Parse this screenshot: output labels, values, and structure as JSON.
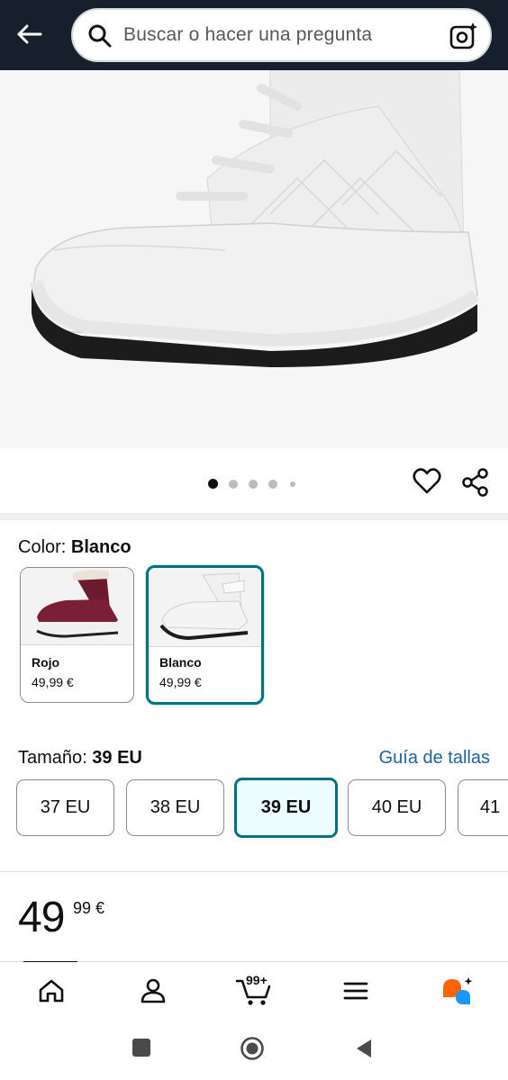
{
  "search": {
    "placeholder": "Buscar o hacer una pregunta"
  },
  "gallery": {
    "image_count": 5,
    "active_index": 0
  },
  "color": {
    "label": "Color:",
    "selected": "Blanco",
    "options": [
      {
        "name": "Rojo",
        "price": "49,99 €",
        "selected": false,
        "tint": "#7a1f36"
      },
      {
        "name": "Blanco",
        "price": "49,99 €",
        "selected": true,
        "tint": "#f2f2f2"
      }
    ]
  },
  "size": {
    "label": "Tamaño:",
    "selected": "39 EU",
    "guide_link": "Guía de tallas",
    "options": [
      "37 EU",
      "38 EU",
      "39 EU",
      "40 EU",
      "41"
    ]
  },
  "price": {
    "whole": "49",
    "fraction": "99 €"
  },
  "nav": {
    "cart_count": "99+"
  },
  "colors": {
    "accent": "#007185",
    "link": "#2162a1",
    "header_bg": "#16202c"
  }
}
